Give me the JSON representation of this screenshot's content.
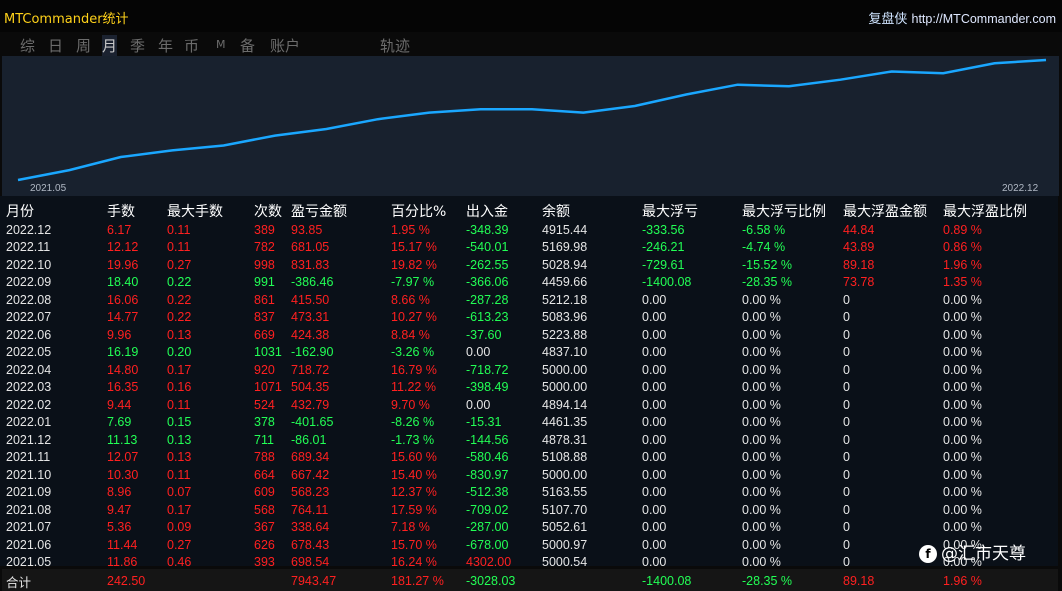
{
  "app_title": "MTCommander统计",
  "brand": {
    "name": "复盘侠",
    "url": "http://MTCommander.com"
  },
  "tabs": [
    {
      "label": "综",
      "active": false
    },
    {
      "label": "日",
      "active": false
    },
    {
      "label": "周",
      "active": false
    },
    {
      "label": "月",
      "active": true
    },
    {
      "label": "季",
      "active": false
    },
    {
      "label": "年",
      "active": false
    },
    {
      "label": "币",
      "active": false
    },
    {
      "label": "M",
      "active": false
    },
    {
      "label": "备",
      "active": false
    },
    {
      "label": "账户",
      "active": false
    },
    {
      "label": "轨迹",
      "active": false
    }
  ],
  "chart_data": {
    "type": "line",
    "x_start_label": "2021.05",
    "x_end_label": "2022.12",
    "line_color": "#1aa7ff",
    "y": [
      0,
      6,
      14,
      18,
      21,
      27,
      31,
      37,
      41,
      43,
      43,
      41,
      45,
      52,
      58,
      57,
      61,
      66,
      65,
      71,
      73
    ]
  },
  "table": {
    "headers": [
      "月份",
      "手数",
      "最大手数",
      "次数",
      "盈亏金额",
      "百分比%",
      "出入金",
      "余额",
      "最大浮亏",
      "最大浮亏比例",
      "最大浮盈金额",
      "最大浮盈比例"
    ],
    "rows": [
      {
        "c": [
          "2022.12",
          "6.17",
          "0.11",
          "389",
          "93.85",
          "1.95 %",
          "-348.39",
          "4915.44",
          "-333.56",
          "-6.58 %",
          "44.84",
          "0.89 %"
        ],
        "k": [
          "w",
          "r",
          "r",
          "r",
          "r",
          "r",
          "g",
          "w",
          "g",
          "g",
          "r",
          "r"
        ]
      },
      {
        "c": [
          "2022.11",
          "12.12",
          "0.11",
          "782",
          "681.05",
          "15.17 %",
          "-540.01",
          "5169.98",
          "-246.21",
          "-4.74 %",
          "43.89",
          "0.86 %"
        ],
        "k": [
          "w",
          "r",
          "r",
          "r",
          "r",
          "r",
          "g",
          "w",
          "g",
          "g",
          "r",
          "r"
        ]
      },
      {
        "c": [
          "2022.10",
          "19.96",
          "0.27",
          "998",
          "831.83",
          "19.82 %",
          "-262.55",
          "5028.94",
          "-729.61",
          "-15.52 %",
          "89.18",
          "1.96 %"
        ],
        "k": [
          "w",
          "r",
          "r",
          "r",
          "r",
          "r",
          "g",
          "w",
          "g",
          "g",
          "r",
          "r"
        ]
      },
      {
        "c": [
          "2022.09",
          "18.40",
          "0.22",
          "991",
          "-386.46",
          "-7.97 %",
          "-366.06",
          "4459.66",
          "-1400.08",
          "-28.35 %",
          "73.78",
          "1.35 %"
        ],
        "k": [
          "w",
          "g",
          "g",
          "g",
          "g",
          "g",
          "g",
          "w",
          "g",
          "g",
          "r",
          "r"
        ]
      },
      {
        "c": [
          "2022.08",
          "16.06",
          "0.22",
          "861",
          "415.50",
          "8.66 %",
          "-287.28",
          "5212.18",
          "0.00",
          "0.00 %",
          "0",
          "0.00 %"
        ],
        "k": [
          "w",
          "r",
          "r",
          "r",
          "r",
          "r",
          "g",
          "w",
          "w",
          "w",
          "w",
          "w"
        ]
      },
      {
        "c": [
          "2022.07",
          "14.77",
          "0.22",
          "837",
          "473.31",
          "10.27 %",
          "-613.23",
          "5083.96",
          "0.00",
          "0.00 %",
          "0",
          "0.00 %"
        ],
        "k": [
          "w",
          "r",
          "r",
          "r",
          "r",
          "r",
          "g",
          "w",
          "w",
          "w",
          "w",
          "w"
        ]
      },
      {
        "c": [
          "2022.06",
          "9.96",
          "0.13",
          "669",
          "424.38",
          "8.84 %",
          "-37.60",
          "5223.88",
          "0.00",
          "0.00 %",
          "0",
          "0.00 %"
        ],
        "k": [
          "w",
          "r",
          "r",
          "r",
          "r",
          "r",
          "g",
          "w",
          "w",
          "w",
          "w",
          "w"
        ]
      },
      {
        "c": [
          "2022.05",
          "16.19",
          "0.20",
          "1031",
          "-162.90",
          "-3.26 %",
          "0.00",
          "4837.10",
          "0.00",
          "0.00 %",
          "0",
          "0.00 %"
        ],
        "k": [
          "w",
          "g",
          "g",
          "g",
          "g",
          "g",
          "w",
          "w",
          "w",
          "w",
          "w",
          "w"
        ]
      },
      {
        "c": [
          "2022.04",
          "14.80",
          "0.17",
          "920",
          "718.72",
          "16.79 %",
          "-718.72",
          "5000.00",
          "0.00",
          "0.00 %",
          "0",
          "0.00 %"
        ],
        "k": [
          "w",
          "r",
          "r",
          "r",
          "r",
          "r",
          "g",
          "w",
          "w",
          "w",
          "w",
          "w"
        ]
      },
      {
        "c": [
          "2022.03",
          "16.35",
          "0.16",
          "1071",
          "504.35",
          "11.22 %",
          "-398.49",
          "5000.00",
          "0.00",
          "0.00 %",
          "0",
          "0.00 %"
        ],
        "k": [
          "w",
          "r",
          "r",
          "r",
          "r",
          "r",
          "g",
          "w",
          "w",
          "w",
          "w",
          "w"
        ]
      },
      {
        "c": [
          "2022.02",
          "9.44",
          "0.11",
          "524",
          "432.79",
          "9.70 %",
          "0.00",
          "4894.14",
          "0.00",
          "0.00 %",
          "0",
          "0.00 %"
        ],
        "k": [
          "w",
          "r",
          "r",
          "r",
          "r",
          "r",
          "w",
          "w",
          "w",
          "w",
          "w",
          "w"
        ]
      },
      {
        "c": [
          "2022.01",
          "7.69",
          "0.15",
          "378",
          "-401.65",
          "-8.26 %",
          "-15.31",
          "4461.35",
          "0.00",
          "0.00 %",
          "0",
          "0.00 %"
        ],
        "k": [
          "w",
          "g",
          "g",
          "g",
          "g",
          "g",
          "g",
          "w",
          "w",
          "w",
          "w",
          "w"
        ]
      },
      {
        "c": [
          "2021.12",
          "11.13",
          "0.13",
          "711",
          "-86.01",
          "-1.73 %",
          "-144.56",
          "4878.31",
          "0.00",
          "0.00 %",
          "0",
          "0.00 %"
        ],
        "k": [
          "w",
          "g",
          "g",
          "g",
          "g",
          "g",
          "g",
          "w",
          "w",
          "w",
          "w",
          "w"
        ]
      },
      {
        "c": [
          "2021.11",
          "12.07",
          "0.13",
          "788",
          "689.34",
          "15.60 %",
          "-580.46",
          "5108.88",
          "0.00",
          "0.00 %",
          "0",
          "0.00 %"
        ],
        "k": [
          "w",
          "r",
          "r",
          "r",
          "r",
          "r",
          "g",
          "w",
          "w",
          "w",
          "w",
          "w"
        ]
      },
      {
        "c": [
          "2021.10",
          "10.30",
          "0.11",
          "664",
          "667.42",
          "15.40 %",
          "-830.97",
          "5000.00",
          "0.00",
          "0.00 %",
          "0",
          "0.00 %"
        ],
        "k": [
          "w",
          "r",
          "r",
          "r",
          "r",
          "r",
          "g",
          "w",
          "w",
          "w",
          "w",
          "w"
        ]
      },
      {
        "c": [
          "2021.09",
          "8.96",
          "0.07",
          "609",
          "568.23",
          "12.37 %",
          "-512.38",
          "5163.55",
          "0.00",
          "0.00 %",
          "0",
          "0.00 %"
        ],
        "k": [
          "w",
          "r",
          "r",
          "r",
          "r",
          "r",
          "g",
          "w",
          "w",
          "w",
          "w",
          "w"
        ]
      },
      {
        "c": [
          "2021.08",
          "9.47",
          "0.17",
          "568",
          "764.11",
          "17.59 %",
          "-709.02",
          "5107.70",
          "0.00",
          "0.00 %",
          "0",
          "0.00 %"
        ],
        "k": [
          "w",
          "r",
          "r",
          "r",
          "r",
          "r",
          "g",
          "w",
          "w",
          "w",
          "w",
          "w"
        ]
      },
      {
        "c": [
          "2021.07",
          "5.36",
          "0.09",
          "367",
          "338.64",
          "7.18 %",
          "-287.00",
          "5052.61",
          "0.00",
          "0.00 %",
          "0",
          "0.00 %"
        ],
        "k": [
          "w",
          "r",
          "r",
          "r",
          "r",
          "r",
          "g",
          "w",
          "w",
          "w",
          "w",
          "w"
        ]
      },
      {
        "c": [
          "2021.06",
          "11.44",
          "0.27",
          "626",
          "678.43",
          "15.70 %",
          "-678.00",
          "5000.97",
          "0.00",
          "0.00 %",
          "0",
          "0.00 %"
        ],
        "k": [
          "w",
          "r",
          "r",
          "r",
          "r",
          "r",
          "g",
          "w",
          "w",
          "w",
          "w",
          "w"
        ]
      },
      {
        "c": [
          "2021.05",
          "11.86",
          "0.46",
          "393",
          "698.54",
          "16.24 %",
          "4302.00",
          "5000.54",
          "0.00",
          "0.00 %",
          "0",
          "0.00 %"
        ],
        "k": [
          "w",
          "r",
          "r",
          "r",
          "r",
          "r",
          "r",
          "w",
          "w",
          "w",
          "w",
          "w"
        ]
      }
    ],
    "total": {
      "c": [
        "合计",
        "242.50",
        "",
        "",
        "7943.47",
        "181.27 %",
        "-3028.03",
        "",
        "-1400.08",
        "-28.35 %",
        "89.18",
        "1.96 %"
      ],
      "k": [
        "w",
        "r",
        "r",
        "r",
        "r",
        "r",
        "g",
        "w",
        "g",
        "g",
        "r",
        "r"
      ]
    }
  },
  "watermark": {
    "icon": "watermark-logo-icon",
    "text": "@汇市天尊"
  }
}
